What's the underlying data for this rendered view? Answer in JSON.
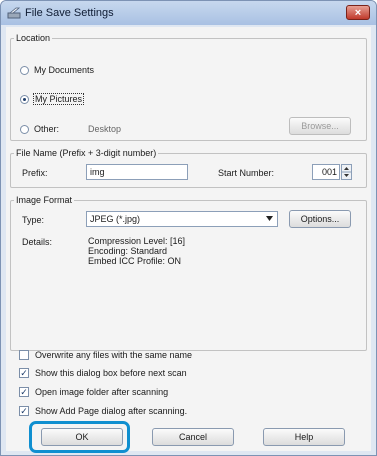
{
  "window": {
    "title": "File Save Settings",
    "close_label": "×"
  },
  "location": {
    "legend": "Location",
    "my_documents": "My Documents",
    "my_pictures": "My Pictures",
    "other": "Other:",
    "other_path": "Desktop",
    "browse_label": "Browse...",
    "selected": "My Pictures"
  },
  "file_name": {
    "legend": "File Name (Prefix + 3-digit number)",
    "prefix_label": "Prefix:",
    "prefix_value": "img",
    "start_number_label": "Start Number:",
    "start_number_value": "001"
  },
  "image_format": {
    "legend": "Image Format",
    "type_label": "Type:",
    "type_value": "JPEG (*.jpg)",
    "options_label": "Options...",
    "details_label": "Details:",
    "details": [
      "Compression Level: [16]",
      "Encoding: Standard",
      "Embed ICC Profile: ON"
    ]
  },
  "checkboxes": [
    {
      "label": "Overwrite any files with the same name",
      "checked": false
    },
    {
      "label": "Show this dialog box before next scan",
      "checked": true
    },
    {
      "label": "Open image folder after scanning",
      "checked": true
    },
    {
      "label": "Show Add Page dialog after scanning.",
      "checked": true
    }
  ],
  "buttons": {
    "ok": "OK",
    "cancel": "Cancel",
    "help": "Help"
  },
  "colors": {
    "highlight": "#0f8fd0",
    "titlebar": "#b8cde9",
    "close": "#c0392b"
  },
  "icons": {
    "app": "scanner-icon",
    "close": "close-icon",
    "spin": "spin-arrows-icon",
    "dropdown": "chevron-down-icon"
  }
}
